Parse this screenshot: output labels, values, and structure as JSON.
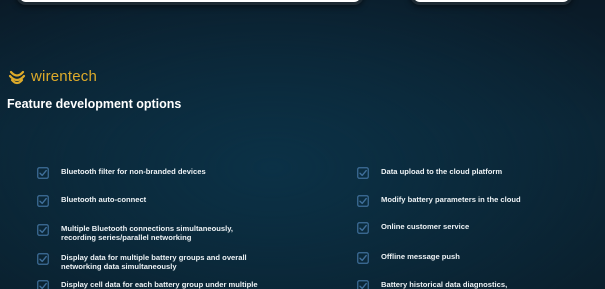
{
  "brand": {
    "name": "wirentech",
    "icon": "wave-logo-icon",
    "color": "#ddaa2a"
  },
  "section": {
    "title": "Feature development options"
  },
  "check_icon": "checkbox-checked-icon",
  "check_color": "#3f6f9a",
  "features_left": [
    {
      "label": "Bluetooth filter for non-branded devices"
    },
    {
      "label": "Bluetooth auto-connect"
    },
    {
      "label": "Multiple Bluetooth connections simultaneously,\nrecording series/parallel networking"
    },
    {
      "label": "Display data for multiple battery groups and overall\nnetworking data simultaneously"
    },
    {
      "label": "Display cell data for each battery group under multiple"
    }
  ],
  "features_right": [
    {
      "label": "Data upload to the cloud platform"
    },
    {
      "label": "Modify battery parameters in the cloud"
    },
    {
      "label": "Online customer service"
    },
    {
      "label": "Offline message push"
    },
    {
      "label": "Battery historical data diagnostics,"
    }
  ]
}
